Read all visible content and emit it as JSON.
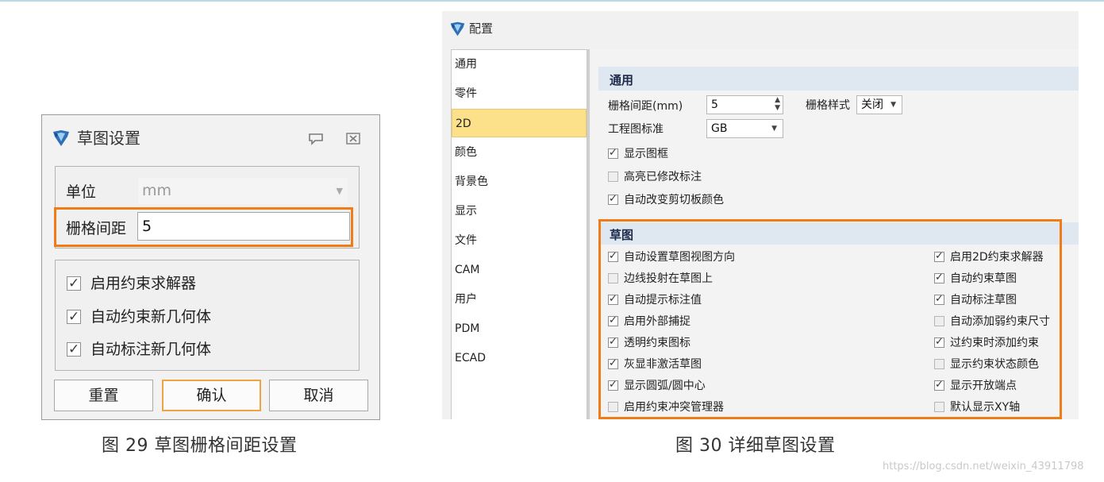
{
  "dialog": {
    "title": "草图设置",
    "unit_label": "单位",
    "unit_value": "mm",
    "grid_label": "栅格间距",
    "grid_value": "5",
    "checkboxes": [
      {
        "label": "启用约束求解器",
        "checked": true
      },
      {
        "label": "自动约束新几何体",
        "checked": true
      },
      {
        "label": "自动标注新几何体",
        "checked": true
      }
    ],
    "buttons": {
      "reset": "重置",
      "ok": "确认",
      "cancel": "取消"
    },
    "caption": "图 29   草图栅格间距设置"
  },
  "config": {
    "title": "配置",
    "nav": [
      "通用",
      "零件",
      "2D",
      "颜色",
      "背景色",
      "显示",
      "文件",
      "CAM",
      "用户",
      "PDM",
      "ECAD"
    ],
    "nav_selected": "2D",
    "general": {
      "section_title": "通用",
      "grid_spacing_label": "栅格间距(mm)",
      "grid_spacing_value": "5",
      "grid_style_label": "栅格样式",
      "grid_style_value": "关闭",
      "drawing_std_label": "工程图标准",
      "drawing_std_value": "GB",
      "checkboxes": [
        {
          "label": "显示图框",
          "checked": true
        },
        {
          "label": "高亮已修改标注",
          "checked": false
        },
        {
          "label": "自动改变剪切板颜色",
          "checked": true
        }
      ]
    },
    "sketch": {
      "section_title": "草图",
      "left": [
        {
          "label": "自动设置草图视图方向",
          "checked": true
        },
        {
          "label": "边线投射在草图上",
          "checked": false
        },
        {
          "label": "自动提示标注值",
          "checked": true
        },
        {
          "label": "启用外部捕捉",
          "checked": true
        },
        {
          "label": "透明约束图标",
          "checked": true
        },
        {
          "label": "灰显非激活草图",
          "checked": true
        },
        {
          "label": "显示圆弧/圆中心",
          "checked": true
        },
        {
          "label": "启用约束冲突管理器",
          "checked": false
        }
      ],
      "right": [
        {
          "label": "启用2D约束求解器",
          "checked": true
        },
        {
          "label": "自动约束草图",
          "checked": true
        },
        {
          "label": "自动标注草图",
          "checked": true
        },
        {
          "label": "自动添加弱约束尺寸",
          "checked": false
        },
        {
          "label": "过约束时添加约束",
          "checked": true
        },
        {
          "label": "显示约束状态颜色",
          "checked": false
        },
        {
          "label": "显示开放端点",
          "checked": true
        },
        {
          "label": "默认显示XY轴",
          "checked": false
        }
      ]
    },
    "caption": "图 30   详细草图设置"
  },
  "watermark": "https://blog.csdn.net/weixin_43911798",
  "icons": {
    "app_logo": "app-logo-icon",
    "message": "message-icon",
    "close": "close-icon"
  },
  "colors": {
    "highlight": "#f07c18",
    "nav_selected": "#fce08a",
    "section_band": "#dfe8f1"
  }
}
